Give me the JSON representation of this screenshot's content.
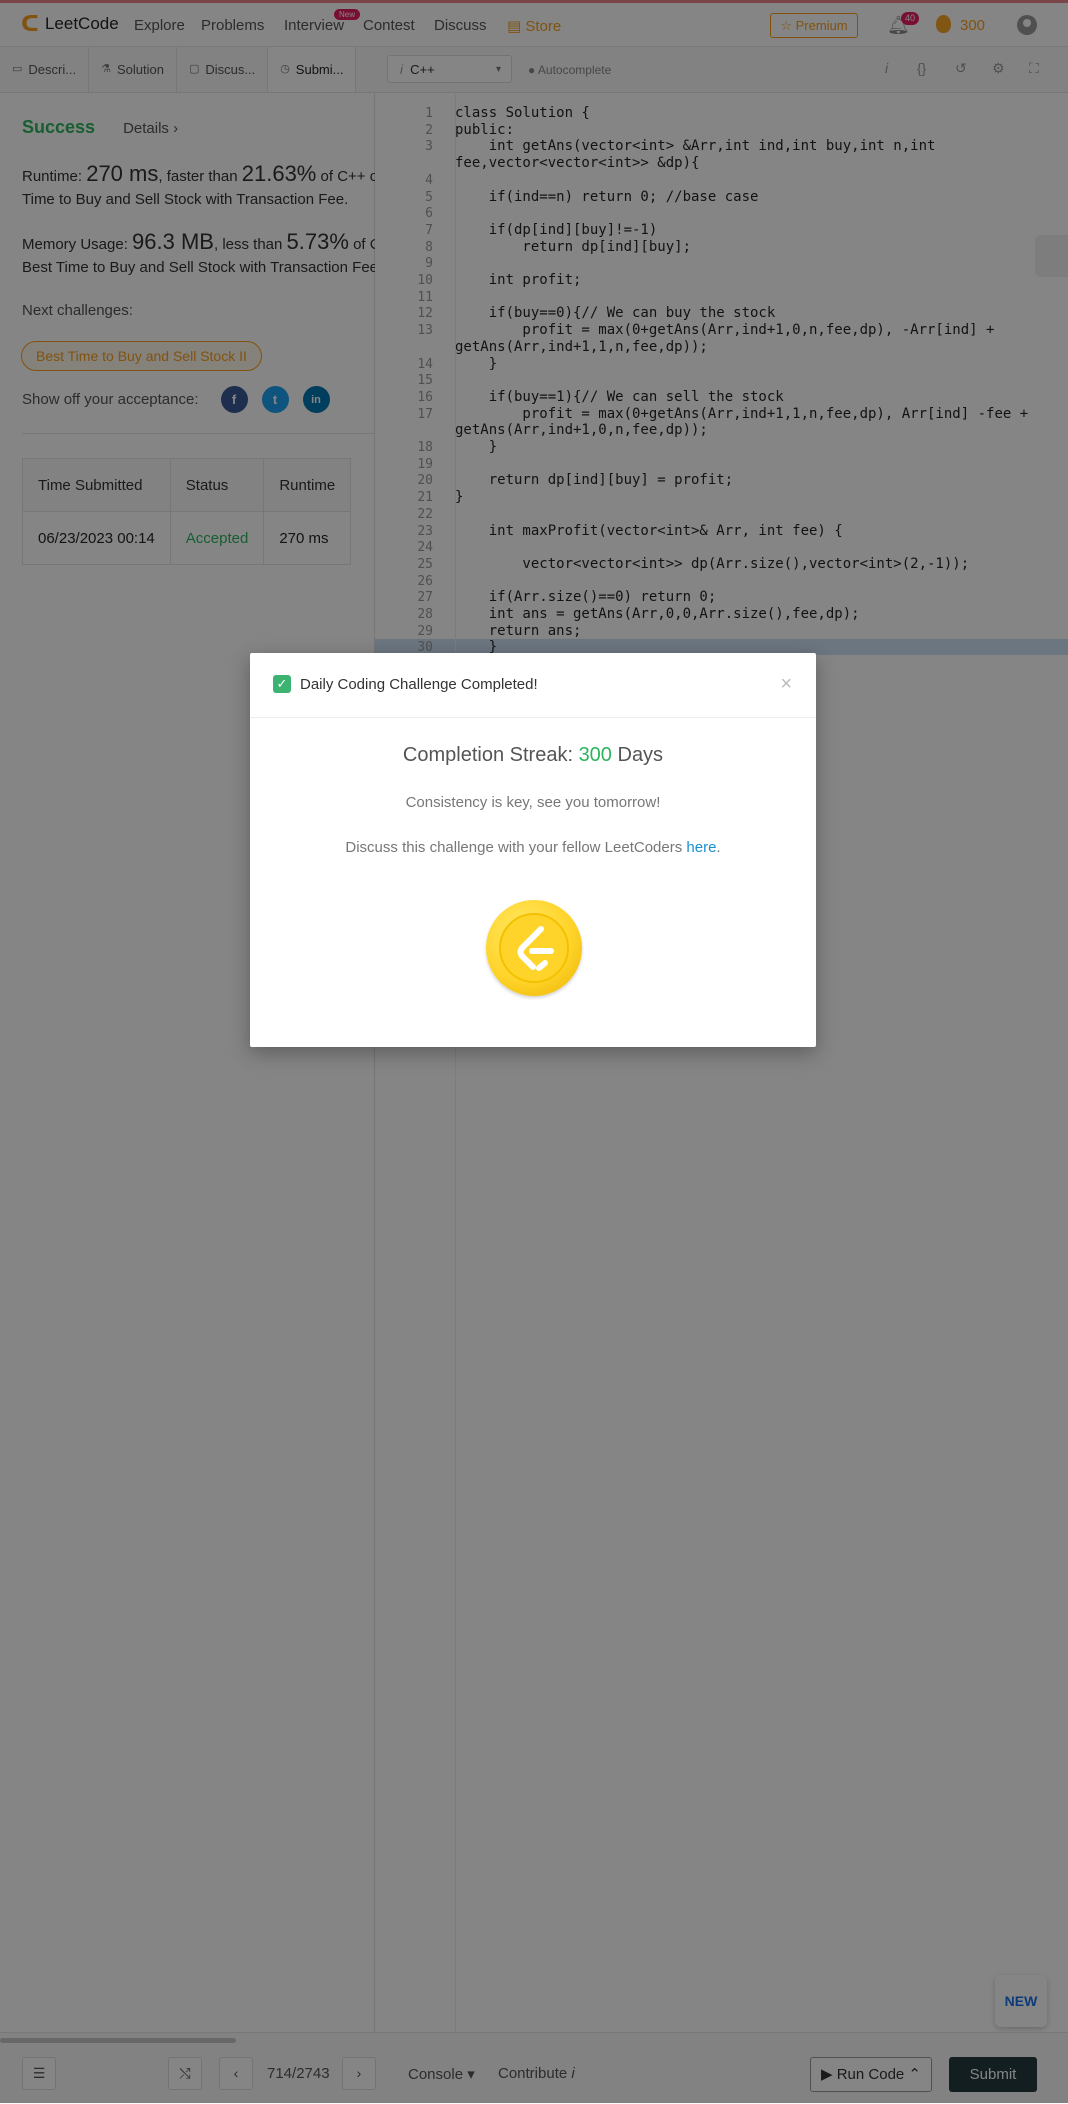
{
  "topnav": {
    "brand": "LeetCode",
    "links": [
      "Explore",
      "Problems",
      "Interview",
      "Contest",
      "Discuss"
    ],
    "new_badge": "New",
    "store": "Store",
    "premium": "Premium",
    "notifications": "40",
    "coins": "300"
  },
  "left": {
    "tabs": [
      "Descri...",
      "Solution",
      "Discus...",
      "Submi..."
    ],
    "status": "Success",
    "details": "Details",
    "runtime_label": "Runtime:",
    "runtime_value": "270 ms",
    "runtime_faster": ", faster than ",
    "runtime_pct": "21.63%",
    "runtime_suffix": " of C++ o",
    "runtime_line2": "Time to Buy and Sell Stock with Transaction Fee.",
    "memory_label": "Memory Usage:",
    "memory_value": "96.3 MB",
    "memory_less": ", less than ",
    "memory_pct": "5.73%",
    "memory_suffix": " of C",
    "memory_line2": "Best Time to Buy and Sell Stock with Transaction Fee",
    "next_challenges": "Next challenges:",
    "challenge": "Best Time to Buy and Sell Stock II",
    "share": "Show off your acceptance:",
    "table_headers": [
      "Time Submitted",
      "Status",
      "Runtime"
    ],
    "table_row": [
      "06/23/2023 00:14",
      "Accepted",
      "270 ms"
    ]
  },
  "editor": {
    "language": "C++",
    "autocomplete": "Autocomplete",
    "line_numbers": [
      "1",
      "2",
      "3",
      "",
      "4",
      "5",
      "6",
      "7",
      "8",
      "9",
      "10",
      "11",
      "12",
      "13",
      "",
      "14",
      "15",
      "16",
      "17",
      "",
      "18",
      "19",
      "20",
      "21",
      "22",
      "23",
      "24",
      "25",
      "26",
      "27",
      "28",
      "29",
      "30"
    ],
    "code_lines": [
      "class Solution {",
      "public:",
      "    int getAns(vector<int> &Arr,int ind,int buy,int n,int",
      "fee,vector<vector<int>> &dp){",
      "",
      "    if(ind==n) return 0; //base case",
      "",
      "    if(dp[ind][buy]!=-1)",
      "        return dp[ind][buy];",
      "",
      "    int profit;",
      "",
      "    if(buy==0){// We can buy the stock",
      "        profit = max(0+getAns(Arr,ind+1,0,n,fee,dp), -Arr[ind] +",
      "getAns(Arr,ind+1,1,n,fee,dp));",
      "    }",
      "",
      "    if(buy==1){// We can sell the stock",
      "        profit = max(0+getAns(Arr,ind+1,1,n,fee,dp), Arr[ind] -fee +",
      "getAns(Arr,ind+1,0,n,fee,dp));",
      "    }",
      "",
      "    return dp[ind][buy] = profit;",
      "}",
      "",
      "    int maxProfit(vector<int>& Arr, int fee) {",
      "",
      "        vector<vector<int>> dp(Arr.size(),vector<int>(2,-1));",
      "",
      "    if(Arr.size()==0) return 0;",
      "    int ans = getAns(Arr,0,0,Arr.size(),fee,dp);",
      "    return ans;",
      "    }"
    ],
    "new_button": "NEW"
  },
  "bottom": {
    "page_counter": "714/2743",
    "console": "Console",
    "contribute": "Contribute",
    "run_code": "Run Code",
    "submit": "Submit"
  },
  "modal": {
    "title": "Daily Coding Challenge Completed!",
    "streak_prefix": "Completion Streak: ",
    "streak_value": "300",
    "streak_suffix": " Days",
    "message": "Consistency is key, see you tomorrow!",
    "discuss_prefix": "Discuss this challenge with your fellow LeetCoders ",
    "discuss_link": "here",
    "discuss_suffix": "."
  }
}
